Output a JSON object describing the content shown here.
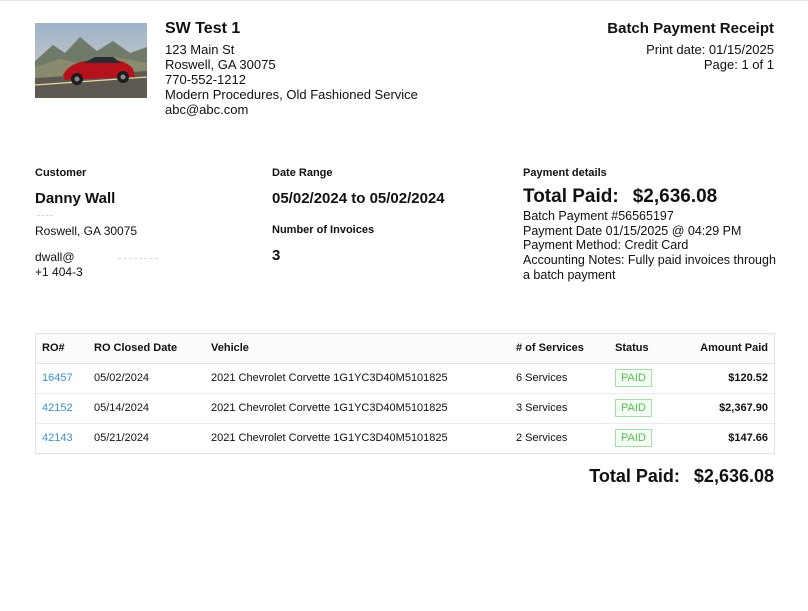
{
  "header": {
    "shop_name": "SW Test 1",
    "address_line1": "123 Main St",
    "address_line2": "Roswell, GA 30075",
    "phone": "770-552-1212",
    "tagline": "Modern Procedures, Old Fashioned Service",
    "email": "abc@abc.com",
    "receipt_title": "Batch Payment Receipt",
    "print_date": "Print date: 01/15/2025",
    "page": "Page: 1 of 1"
  },
  "customer": {
    "label": "Customer",
    "name": "Danny Wall",
    "city_line": "Roswell, GA 30075",
    "email_partial": "dwall@",
    "phone_partial": "+1 404-3"
  },
  "date_range": {
    "label": "Date Range",
    "value": "05/02/2024 to 05/02/2024",
    "invoices_label": "Number of Invoices",
    "invoices_count": "3"
  },
  "payment": {
    "label": "Payment details",
    "total_label": "Total Paid:",
    "total_value": "$2,636.08",
    "batch": "Batch Payment #56565197",
    "date": "Payment Date 01/15/2025 @ 04:29 PM",
    "method": "Payment Method: Credit Card",
    "notes": "Accounting Notes: Fully paid invoices through a batch payment"
  },
  "table": {
    "headers": [
      "RO#",
      "RO Closed Date",
      "Vehicle",
      "# of Services",
      "Status",
      "Amount Paid"
    ],
    "rows": [
      {
        "ro": "16457",
        "closed": "05/02/2024",
        "vehicle": "2021 Chevrolet Corvette 1G1YC3D40M5101825",
        "services": "6 Services",
        "status": "PAID",
        "amount": "$120.52"
      },
      {
        "ro": "42152",
        "closed": "05/14/2024",
        "vehicle": "2021 Chevrolet Corvette 1G1YC3D40M5101825",
        "services": "3 Services",
        "status": "PAID",
        "amount": "$2,367.90"
      },
      {
        "ro": "42143",
        "closed": "05/21/2024",
        "vehicle": "2021 Chevrolet Corvette 1G1YC3D40M5101825",
        "services": "2 Services",
        "status": "PAID",
        "amount": "$147.66"
      }
    ]
  },
  "footer": {
    "total_label": "Total Paid:",
    "total_value": "$2,636.08"
  },
  "colors": {
    "link": "#3d8fce",
    "paid_badge": "#5ab95a"
  }
}
